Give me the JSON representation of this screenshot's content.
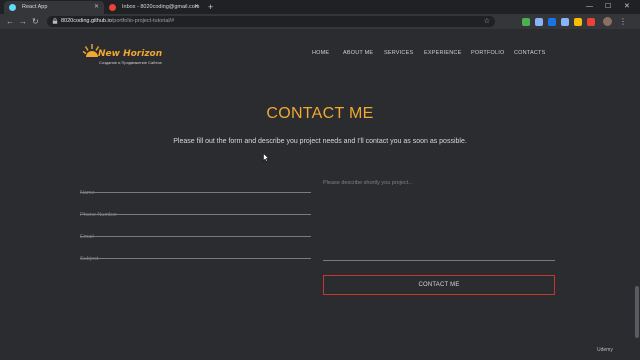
{
  "browser": {
    "tabs": [
      {
        "title": "React App",
        "favicon_color": "#61dafb"
      },
      {
        "title": "Inbox - 8020coding@gmail.com",
        "favicon_color": "#ea4335"
      }
    ],
    "url_host": "8020coding.github.io",
    "url_path": "/portfolio-project-tutorial/#",
    "extension_colors": [
      "#4caf50",
      "#8ab4f8",
      "#1a73e8",
      "#8ab4f8",
      "#fbbc04",
      "#ea4335",
      "#e0e0e0",
      "#e0e0e0"
    ]
  },
  "header": {
    "brand": "New Horizon",
    "tagline": "Создание и Продвижение Сайтов",
    "nav": [
      "HOME",
      "ABOUT ME",
      "SERVICES",
      "EXPERIENCE",
      "PORTFOLIO",
      "CONTACTS"
    ]
  },
  "contact": {
    "title": "CONTACT ME",
    "subtitle": "Please fill out the form and describe you project needs and I'll contact you as soon as possible.",
    "fields": {
      "name": "Name",
      "phone": "Phone Number",
      "email": "Email",
      "subject": "Subject"
    },
    "message_placeholder": "Please describe shortly you project...",
    "submit_label": "CONTACT ME"
  },
  "watermark": "Udemy",
  "colors": {
    "accent": "#f0a830",
    "button_border": "#c0392b",
    "background": "#2b2c30"
  }
}
